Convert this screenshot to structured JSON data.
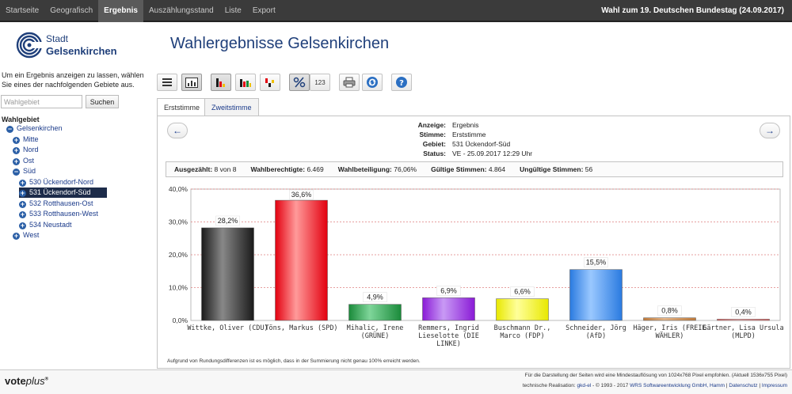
{
  "nav": {
    "items": [
      "Startseite",
      "Geografisch",
      "Ergebnis",
      "Auszählungsstand",
      "Liste",
      "Export"
    ],
    "active_index": 2,
    "election_title": "Wahl zum 19. Deutschen Bundestag (24.09.2017)"
  },
  "logo": {
    "line1": "Stadt",
    "line2": "Gelsenkirchen"
  },
  "page_title": "Wahlergebnisse Gelsenkirchen",
  "sidebar": {
    "hint": "Um ein Ergebnis anzeigen zu lassen, wählen Sie eines der nachfolgenden Gebiete aus.",
    "search_placeholder": "Wahlgebiet",
    "search_button": "Suchen",
    "tree_heading": "Wahlgebiet",
    "tree": [
      {
        "label": "Gelsenkirchen",
        "level": 0,
        "expanded": true
      },
      {
        "label": "Mitte",
        "level": 1,
        "expanded": false
      },
      {
        "label": "Nord",
        "level": 1,
        "expanded": false
      },
      {
        "label": "Ost",
        "level": 1,
        "expanded": false
      },
      {
        "label": "Süd",
        "level": 1,
        "expanded": true
      },
      {
        "label": "530 Ückendorf-Nord",
        "level": 2,
        "expanded": false
      },
      {
        "label": "531 Ückendorf-Süd",
        "level": 2,
        "expanded": false,
        "selected": true
      },
      {
        "label": "532 Rotthausen-Ost",
        "level": 2,
        "expanded": false
      },
      {
        "label": "533 Rotthausen-West",
        "level": 2,
        "expanded": false
      },
      {
        "label": "534 Neustadt",
        "level": 2,
        "expanded": false
      },
      {
        "label": "West",
        "level": 1,
        "expanded": false
      }
    ]
  },
  "toolbar": {
    "number_label": "123",
    "icons": [
      "list-icon",
      "table-chart-icon",
      "bar-chart-icon",
      "party-bar-chart-icon",
      "gain-loss-chart-icon",
      "percent-icon",
      "numbers-icon",
      "print-icon",
      "refresh-icon",
      "help-icon"
    ]
  },
  "tabs": [
    {
      "label": "Erststimme",
      "active": true
    },
    {
      "label": "Zweitstimme",
      "active": false
    }
  ],
  "info": {
    "rows": [
      {
        "label": "Anzeige:",
        "value": "Ergebnis"
      },
      {
        "label": "Stimme:",
        "value": "Erststimme"
      },
      {
        "label": "Gebiet:",
        "value": "531 Ückendorf-Süd"
      },
      {
        "label": "Status:",
        "value": "VE - 25.09.2017 12:29 Uhr"
      }
    ]
  },
  "summary": [
    {
      "label": "Ausgezählt:",
      "value": "8 von 8"
    },
    {
      "label": "Wahlberechtigte:",
      "value": "6.469"
    },
    {
      "label": "Wahlbeteiligung:",
      "value": "76,06%"
    },
    {
      "label": "Gültige Stimmen:",
      "value": "4.864"
    },
    {
      "label": "Ungültige Stimmen:",
      "value": "56"
    }
  ],
  "chart_data": {
    "type": "bar",
    "categories": [
      [
        "Wittke, Oliver (CDU)"
      ],
      [
        "Töns, Markus (SPD)"
      ],
      [
        "Mihalic, Irene",
        "(GRÜNE)"
      ],
      [
        "Remmers, Ingrid",
        "Lieselotte (DIE",
        "LINKE)"
      ],
      [
        "Buschmann Dr.,",
        "Marco (FDP)"
      ],
      [
        "Schneider, Jörg",
        "(AfD)"
      ],
      [
        "Häger, Iris (FREIE",
        "WÄHLER)"
      ],
      [
        "Gärtner, Lisa Ursula",
        "(MLPD)"
      ]
    ],
    "values": [
      28.2,
      36.6,
      4.9,
      6.9,
      6.6,
      15.5,
      0.8,
      0.4
    ],
    "value_labels": [
      "28,2%",
      "36,6%",
      "4,9%",
      "6,9%",
      "6,6%",
      "15,5%",
      "0,8%",
      "0,4%"
    ],
    "colors": [
      "#1a1a1a",
      "#e3000f",
      "#1a8a3a",
      "#8a1ad6",
      "#e8e800",
      "#2a7ae0",
      "#c07a3a",
      "#e86a6a"
    ],
    "highlight": [
      "#888888",
      "#ff9a9a",
      "#7fd69a",
      "#c89af5",
      "#ffff9a",
      "#9ac8ff",
      "#e8b88a",
      "#ffb0b0"
    ],
    "yticks": [
      "0,0%",
      "10,0%",
      "20,0%",
      "30,0%",
      "40,0%"
    ],
    "ylim": [
      0,
      40
    ],
    "grid": true,
    "footnote": "Aufgrund von Rundungsdifferenzen ist es möglich, dass in der Summierung nicht genau 100% erreicht werden."
  },
  "footer": {
    "brand_main": "vote",
    "brand_italic": "plus",
    "brand_mark": "®",
    "line1": "Für die Darstellung der Seiten wird eine Mindestauflösung von 1024x768 Pixel empfohlen. (Aktuell 1536x755 Pixel)",
    "line2_prefix": "technische Realisation:",
    "line2_link1": "gkd-el",
    "line2_mid": "- © 1993 - 2017",
    "line2_link2": "WRS Softwareentwicklung GmbH, Hamm",
    "line2_link3": "Datenschutz",
    "line2_link4": "Impressum"
  }
}
